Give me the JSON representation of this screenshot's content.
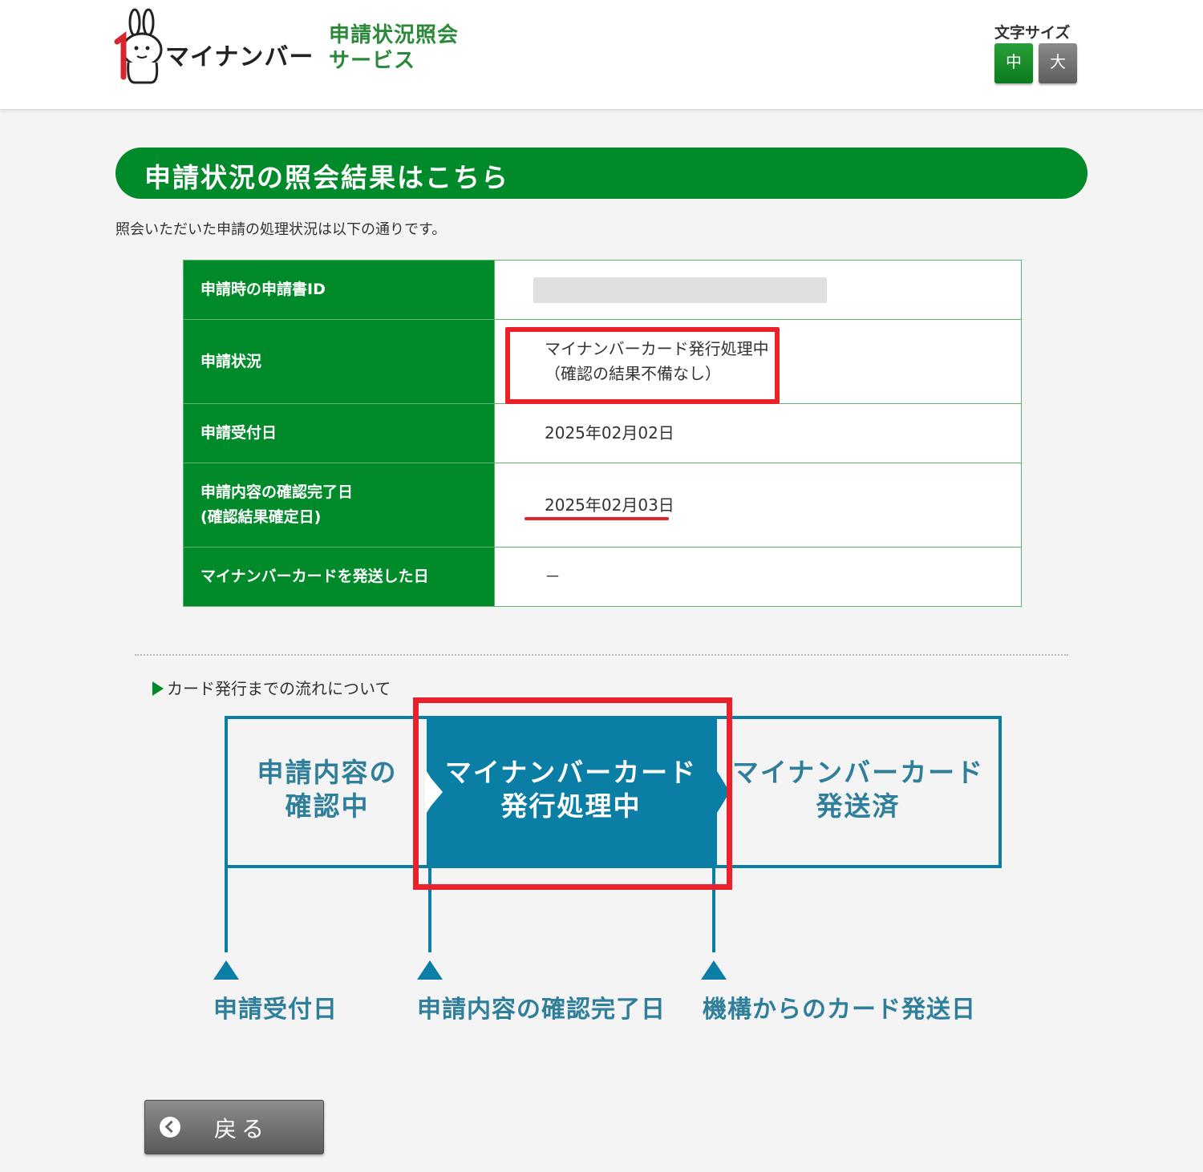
{
  "header": {
    "logo_text": "マイナンバー",
    "service_title_line1": "申請状況照会",
    "service_title_line2": "サービス",
    "font_size_label": "文字サイズ",
    "font_size_medium": "中",
    "font_size_large": "大"
  },
  "heading": "申請状況の照会結果はこちら",
  "intro": "照会いただいた申請の処理状況は以下の通りです。",
  "table": {
    "rows": [
      {
        "label": "申請時の申請書ID",
        "value": ""
      },
      {
        "label": "申請状況",
        "value_line1": "マイナンバーカード発行処理中",
        "value_line2": "（確認の結果不備なし）"
      },
      {
        "label": "申請受付日",
        "value": "2025年02月02日"
      },
      {
        "label_line1": "申請内容の確認完了日",
        "label_line2": "(確認結果確定日)",
        "value": "2025年02月03日"
      },
      {
        "label": "マイナンバーカードを発送した日",
        "value": "－"
      }
    ]
  },
  "flow": {
    "title": "カード発行までの流れについて",
    "steps": [
      {
        "line1": "申請内容の",
        "line2": "確認中"
      },
      {
        "line1": "マイナンバーカード",
        "line2": "発行処理中"
      },
      {
        "line1": "マイナンバーカード",
        "line2": "発送済"
      }
    ],
    "milestones": [
      "申請受付日",
      "申請内容の確認完了日",
      "機構からのカード発送日"
    ]
  },
  "back_button": "戻る",
  "colors": {
    "green": "#008a2a",
    "flow_blue": "#0a7ea4",
    "highlight_red": "#e8212a"
  }
}
